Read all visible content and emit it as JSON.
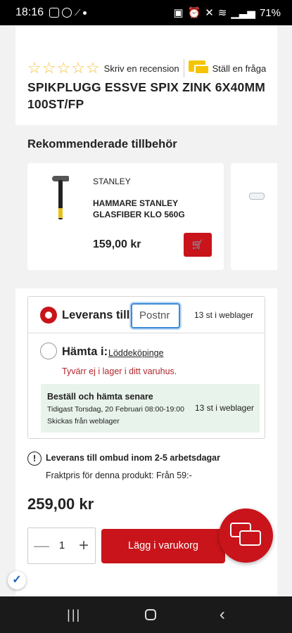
{
  "status_bar": {
    "time": "18:16",
    "battery": "71%"
  },
  "product": {
    "stars": [
      "☆",
      "☆",
      "☆",
      "☆",
      "☆"
    ],
    "write_review": "Skriv en recension",
    "ask_question": "Ställ en fråga",
    "title": "SPIKPLUGG ESSVE SPIX ZINK 6X40MM 100ST/FP",
    "price": "259,00 kr"
  },
  "recommended": {
    "heading": "Rekommenderade tillbehör",
    "items": [
      {
        "brand": "STANLEY",
        "name": "HAMMARE STANLEY GLASFIBER KLO 560G",
        "price": "159,00 kr"
      }
    ]
  },
  "delivery": {
    "leverans_label": "Leverans till:",
    "postnr_placeholder": "Postnr",
    "web_stock": "13 st i weblager",
    "pickup_label": "Hämta i:",
    "store": "Löddeköpinge",
    "not_in_stock": "Tyvärr ej i lager i ditt varuhus.",
    "order_later_title": "Beställ och hämta senare",
    "order_later_time": "Tidigast Torsdag, 20 Februari 08:00-19:00",
    "order_later_ship": "Skickas från weblager",
    "order_later_stock": "13 st i weblager"
  },
  "shipping": {
    "agent": "Leverans till ombud inom 2-5 arbetsdagar",
    "freight": "Fraktpris för denna produkt: Från 59:-"
  },
  "cart": {
    "quantity": "1",
    "minus": "—",
    "plus": "+",
    "add_label": "Lägg i varukorg"
  }
}
